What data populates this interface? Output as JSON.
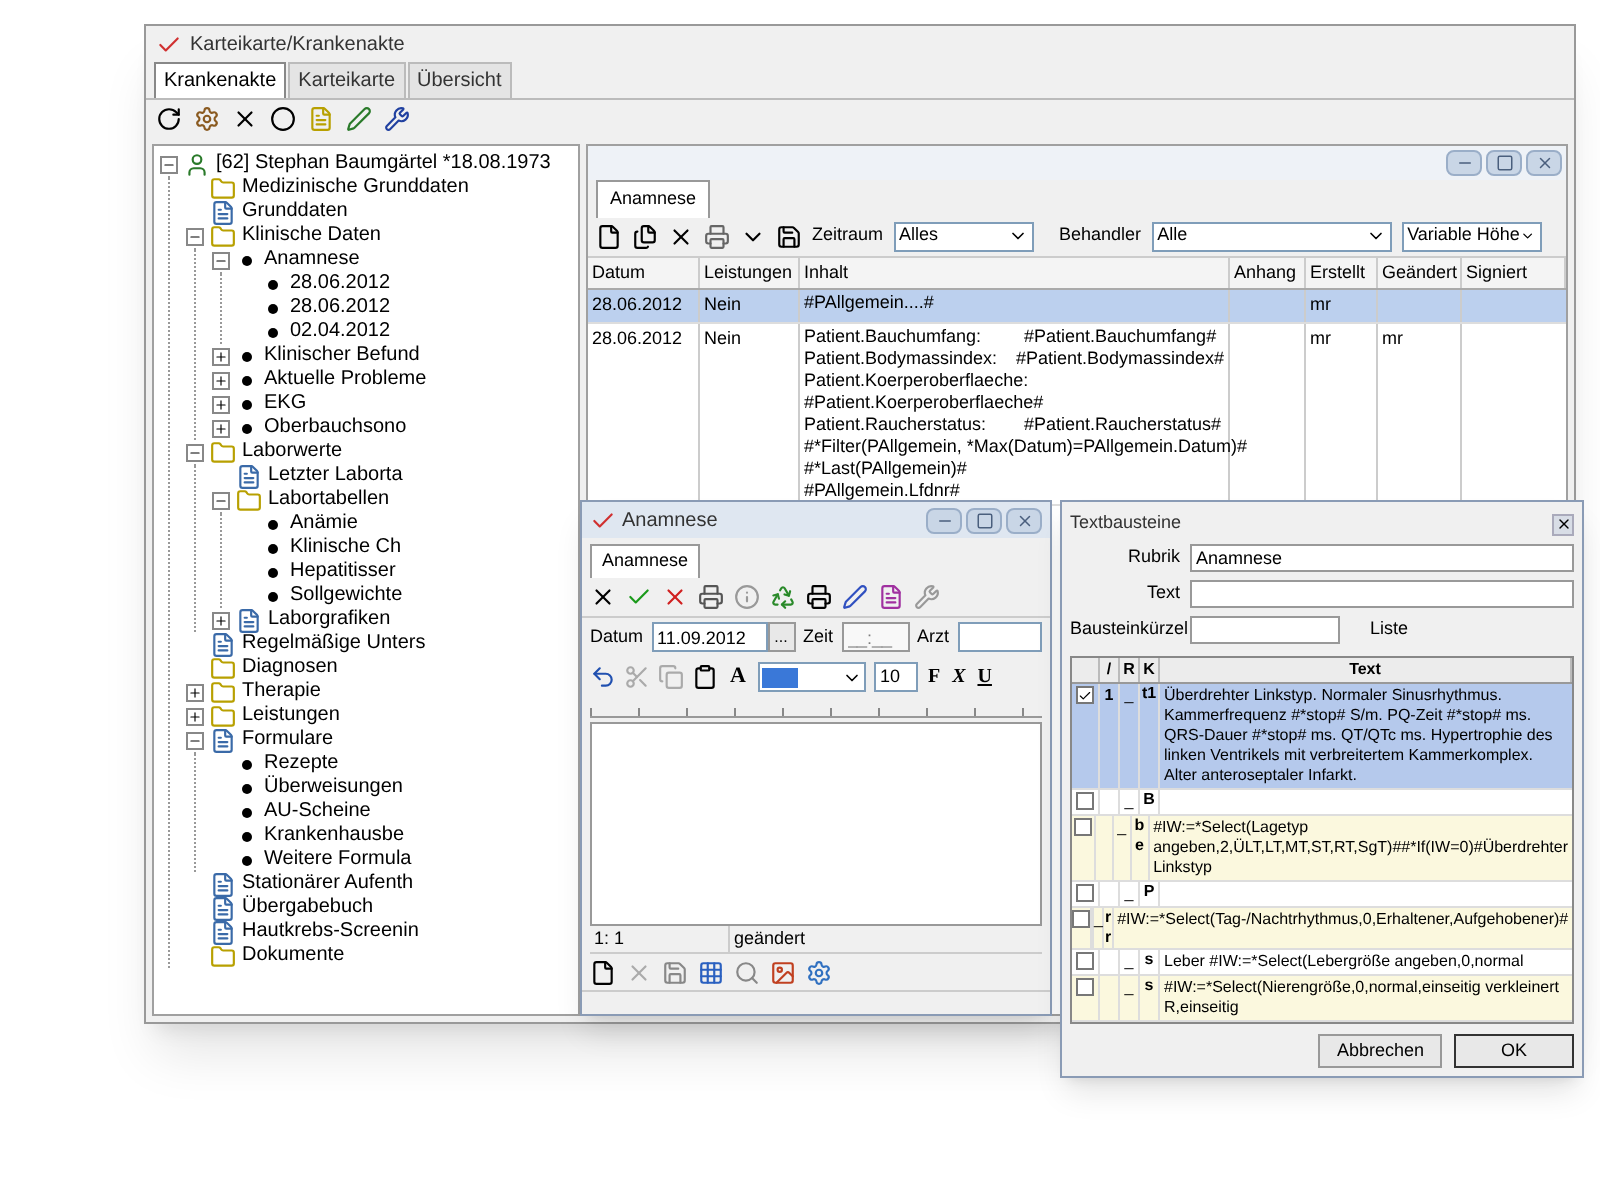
{
  "window": {
    "title": "Karteikarte/Krankenakte"
  },
  "tabs": [
    {
      "label": "Krankenakte",
      "selected": true
    },
    {
      "label": "Karteikarte",
      "selected": false
    },
    {
      "label": "Übersicht",
      "selected": false
    }
  ],
  "tree": [
    {
      "label": "[62] Stephan Baumgärtel *18.08.1973",
      "kind": "patient",
      "expanded": true,
      "children": [
        {
          "label": "Medizinische Grunddaten",
          "kind": "folder"
        },
        {
          "label": "Grunddaten",
          "kind": "document"
        },
        {
          "label": "Klinische Daten",
          "kind": "folder",
          "expanded": true,
          "children": [
            {
              "label": "Anamnese",
              "kind": "bullet",
              "expanded": true,
              "children": [
                {
                  "label": "28.06.2012",
                  "kind": "bullet"
                },
                {
                  "label": "28.06.2012",
                  "kind": "bullet"
                },
                {
                  "label": "02.04.2012",
                  "kind": "bullet"
                }
              ]
            },
            {
              "label": "Klinischer Befund",
              "kind": "bullet",
              "expanded": false
            },
            {
              "label": "Aktuelle Probleme",
              "kind": "bullet",
              "expanded": false
            },
            {
              "label": "EKG",
              "kind": "bullet",
              "expanded": false
            },
            {
              "label": "Oberbauchsono",
              "kind": "bullet",
              "expanded": false
            }
          ]
        },
        {
          "label": "Laborwerte",
          "kind": "folder",
          "expanded": true,
          "children": [
            {
              "label": "Letzter Laborta",
              "kind": "document"
            },
            {
              "label": "Labortabellen",
              "kind": "folder",
              "expanded": true,
              "children": [
                {
                  "label": "Anämie",
                  "kind": "bullet"
                },
                {
                  "label": "Klinische Ch",
                  "kind": "bullet"
                },
                {
                  "label": "Hepatitisser",
                  "kind": "bullet"
                },
                {
                  "label": "Sollgewichte",
                  "kind": "bullet"
                }
              ]
            },
            {
              "label": "Laborgrafiken",
              "kind": "document",
              "expanded": false
            }
          ]
        },
        {
          "label": "Regelmäßige Unters",
          "kind": "document"
        },
        {
          "label": "Diagnosen",
          "kind": "folder"
        },
        {
          "label": "Therapie",
          "kind": "folder",
          "expanded": false
        },
        {
          "label": "Leistungen",
          "kind": "folder",
          "expanded": false
        },
        {
          "label": "Formulare",
          "kind": "document",
          "expanded": true,
          "children": [
            {
              "label": "Rezepte",
              "kind": "bullet"
            },
            {
              "label": "Überweisungen",
              "kind": "bullet"
            },
            {
              "label": "AU-Scheine",
              "kind": "bullet"
            },
            {
              "label": "Krankenhausbe",
              "kind": "bullet"
            },
            {
              "label": "Weitere Formula",
              "kind": "bullet"
            }
          ]
        },
        {
          "label": "Stationärer Aufenth",
          "kind": "document"
        },
        {
          "label": "Übergabebuch",
          "kind": "document"
        },
        {
          "label": "Hautkrebs-Screenin",
          "kind": "document"
        },
        {
          "label": "Dokumente",
          "kind": "folder"
        }
      ]
    }
  ],
  "anamnese_panel": {
    "tab": "Anamnese",
    "zeitraum_label": "Zeitraum",
    "zeitraum_value": "Alles",
    "behandler_label": "Behandler",
    "behandler_value": "Alle",
    "height_mode": "Variable Höhe",
    "columns": [
      "Datum",
      "Leistungen",
      "Inhalt",
      "Anhang",
      "Erstellt",
      "Geändert",
      "Signiert"
    ],
    "rows": [
      {
        "selected": true,
        "datum": "28.06.2012",
        "leistungen": "Nein",
        "inhalt": [
          {
            "label": "#PAllgemein....#"
          }
        ],
        "erstellt": "mr"
      },
      {
        "selected": false,
        "datum": "28.06.2012",
        "leistungen": "Nein",
        "inhalt": [
          {
            "label": "Patient.Bauchumfang:",
            "value": "#Patient.Bauchumfang#"
          },
          {
            "label": "Patient.Bodymassindex:",
            "value": "#Patient.Bodymassindex#"
          },
          {
            "label": "Patient.Koerperoberflaeche:"
          },
          {
            "label": "#Patient.Koerperoberflaeche#"
          },
          {
            "label": "Patient.Raucherstatus:",
            "value": "#Patient.Raucherstatus#"
          },
          {
            "label": "#*Filter(PAllgemein, *Max(Datum)=PAllgemein.Datum)#"
          },
          {
            "label": "#*Last(PAllgemein)#"
          },
          {
            "label": "#PAllgemein.Lfdnr#"
          }
        ],
        "erstellt": "mr",
        "geaendert": "mr"
      }
    ]
  },
  "anamnese_dialog": {
    "title": "Anamnese",
    "tab": "Anamnese",
    "datum_label": "Datum",
    "datum": "11.09.2012",
    "datum_button": "...",
    "zeit_label": "Zeit",
    "zeit_placeholder": "__:__",
    "arzt_label": "Arzt",
    "font_button": "A",
    "font_size": "10",
    "format_buttons": [
      "F",
      "X",
      "U"
    ],
    "position": "1: 1",
    "status": "geändert"
  },
  "textbausteine": {
    "title": "Textbausteine",
    "rubrik_label": "Rubrik",
    "rubrik": "Anamnese",
    "text_label": "Text",
    "kuerzel_label": "Bausteinkürzel",
    "liste_label": "Liste",
    "columns": [
      "/",
      "R",
      "K",
      "Text"
    ],
    "rows": [
      {
        "checked": true,
        "selected": true,
        "nr": "1",
        "r": "_",
        "k": "t1",
        "text": "Überdrehter Linkstyp. Normaler Sinusrhythmus. Kammerfrequenz #*stop# S/m. PQ-Zeit #*stop# ms. QRS-Dauer #*stop# ms. QT/QTc ms. Hypertrophie des linken Ventrikels mit verbreitertem Kammerkomplex. Alter anteroseptaler Infarkt."
      },
      {
        "checked": false,
        "selected": false,
        "r": "_",
        "k": "B"
      },
      {
        "checked": false,
        "selected": false,
        "r": "_",
        "k": "be",
        "text": "#IW:=*Select(Lagetyp angeben,2,ÜLT,LT,MT,ST,RT,SgT)##*If(IW=0)#Überdrehter Linkstyp"
      },
      {
        "checked": false,
        "selected": false,
        "r": "_",
        "k": "P"
      },
      {
        "checked": false,
        "selected": false,
        "r": "_",
        "k": "rr",
        "text": "#IW:=*Select(Tag-/Nachtrhythmus,0,Erhaltener,Aufgehobener)#"
      },
      {
        "checked": false,
        "selected": false,
        "r": "_",
        "k": "s",
        "text": "Leber #IW:=*Select(Lebergröße angeben,0,normal"
      },
      {
        "checked": false,
        "selected": false,
        "r": "_",
        "k": "s",
        "text": "#IW:=*Select(Nierengröße,0,normal,einseitig verkleinert R,einseitig"
      }
    ],
    "buttons": [
      "Abbrechen",
      "OK"
    ]
  }
}
